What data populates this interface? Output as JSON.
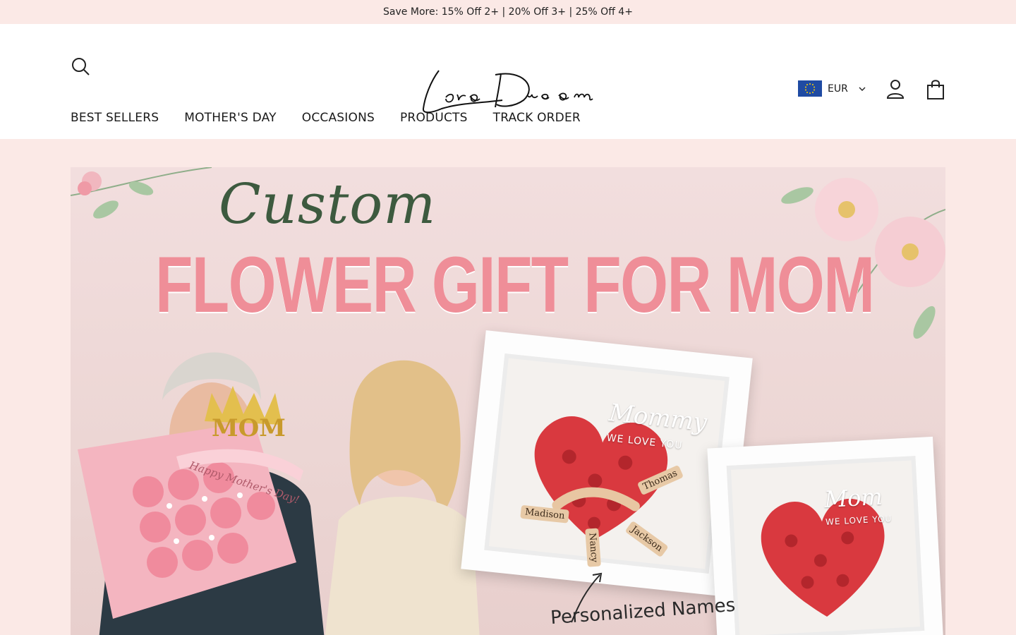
{
  "announcement": "Save More: 15% Off 2+ | 20% Off 3+ | 25% Off 4+",
  "logo_alt": "Lora Dream",
  "currency": {
    "code": "EUR"
  },
  "nav": [
    {
      "label": "BEST SELLERS"
    },
    {
      "label": "MOTHER'S DAY"
    },
    {
      "label": "OCCASIONS"
    },
    {
      "label": "PRODUCTS"
    },
    {
      "label": "TRACK ORDER"
    }
  ],
  "hero": {
    "script": "Custom",
    "title": "FLOWER GIFT FOR MOM",
    "frame1_heading": "Mommy",
    "frame1_sub": "WE LOVE YOU",
    "frame2_heading": "Mom",
    "frame2_sub": "WE LOVE YOU",
    "names": [
      "Thomas",
      "Madison",
      "Jackson",
      "Nancy"
    ],
    "ribbon": "Happy Mother's Day!",
    "crown": "MOM",
    "caption": "Personalized Names"
  },
  "colors": {
    "announce_bg": "#fbe9e6",
    "title_pink": "#ef8e98",
    "script_green": "#3d5a3f"
  }
}
